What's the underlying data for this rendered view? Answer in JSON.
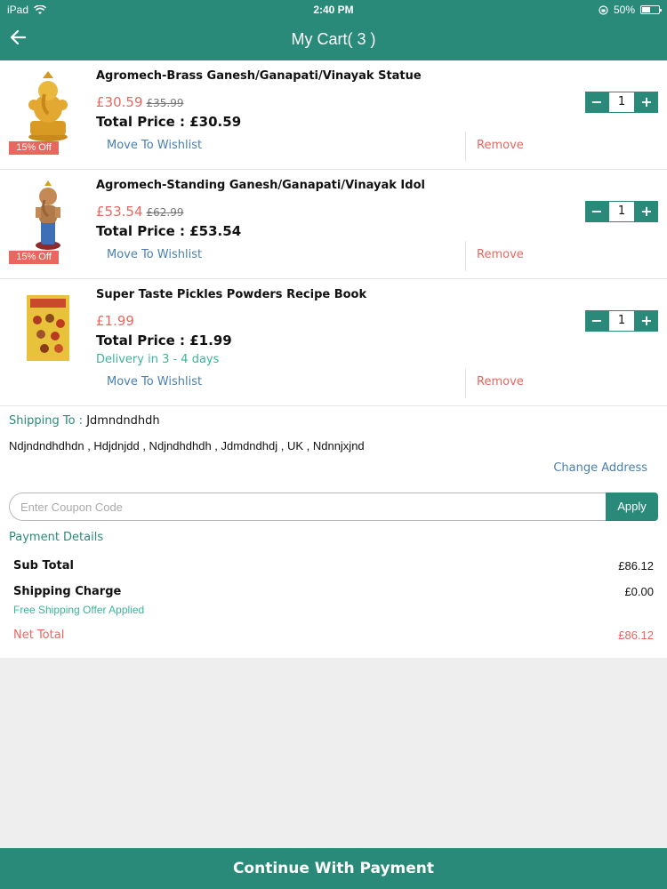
{
  "status_bar": {
    "device": "iPad",
    "time": "2:40 PM",
    "battery": "50%"
  },
  "header": {
    "title": "My Cart( 3 )"
  },
  "items": [
    {
      "name": "Agromech-Brass Ganesh/Ganapati/Vinayak Statue",
      "price": "£30.59",
      "old_price": "£35.99",
      "total_label": "Total Price : £30.59",
      "badge": "15% Off",
      "qty": "1",
      "wishlist_label": "Move To Wishlist",
      "remove_label": "Remove"
    },
    {
      "name": "Agromech-Standing Ganesh/Ganapati/Vinayak Idol",
      "price": "£53.54",
      "old_price": "£62.99",
      "total_label": "Total Price : £53.54",
      "badge": "15% Off",
      "qty": "1",
      "wishlist_label": "Move To Wishlist",
      "remove_label": "Remove"
    },
    {
      "name": "Super Taste Pickles Powders Recipe Book",
      "price": "£1.99",
      "total_label": "Total Price : £1.99",
      "delivery": "Delivery in 3 - 4 days",
      "qty": "1",
      "wishlist_label": "Move To Wishlist",
      "remove_label": "Remove"
    }
  ],
  "shipping": {
    "label": "Shipping To : ",
    "name": "Jdmndndhdh",
    "address": "Ndjndndhdhdn , Hdjdnjdd , Ndjndhdhdh , Jdmdndhdj , UK , Ndnnjxjnd",
    "change_label": "Change Address"
  },
  "coupon": {
    "placeholder": "Enter Coupon Code",
    "value": "",
    "apply_label": "Apply"
  },
  "payment": {
    "title": "Payment Details",
    "sub_total_label": "Sub Total",
    "sub_total": "£86.12",
    "shipping_label": "Shipping Charge",
    "shipping": "£0.00",
    "free_shipping_note": "Free Shipping Offer Applied",
    "net_total_label": "Net Total",
    "net_total": "£86.12"
  },
  "footer": {
    "continue_label": "Continue With Payment"
  },
  "colors": {
    "primary": "#2a8a7a",
    "accent_red": "#e8675f",
    "link_blue": "#4a7fb0",
    "success_green": "#3bb59a"
  }
}
